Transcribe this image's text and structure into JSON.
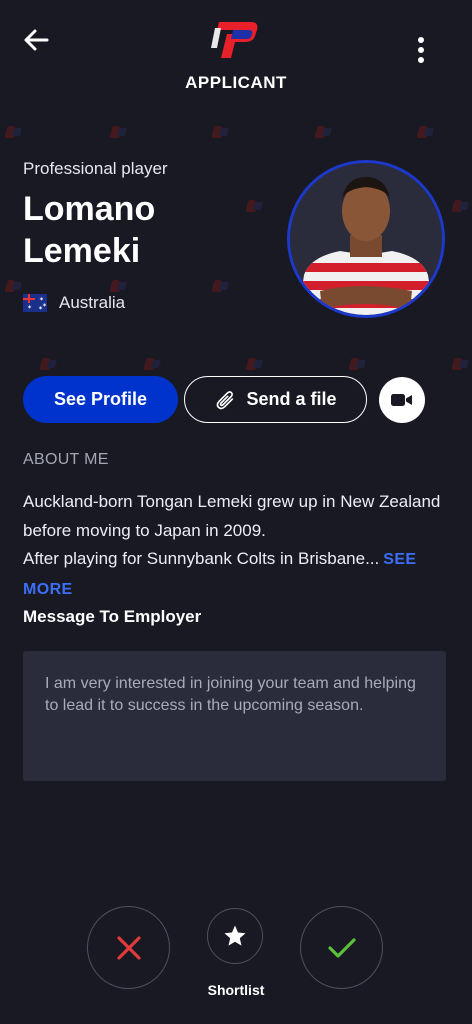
{
  "header": {
    "title": "APPLICANT",
    "back_icon": "arrow-left-icon",
    "menu_icon": "more-vertical-icon"
  },
  "applicant": {
    "role": "Professional player",
    "name": "Lomano Lemeki",
    "country": "Australia"
  },
  "actions": {
    "see_profile": "See Profile",
    "send_file": "Send a file",
    "video_icon": "video-camera-icon"
  },
  "about": {
    "heading": "ABOUT ME",
    "text_line1": "Auckland-born Tongan Lemeki grew up in New Zealand before moving to Japan in 2009.",
    "text_line2": "After playing for Sunnybank Colts in Brisbane...",
    "see_more": "SEE MORE"
  },
  "message": {
    "heading": "Message To Employer",
    "body": "I am very interested in joining your team and helping to lead it to success in the upcoming season."
  },
  "decision": {
    "shortlist_label": "Shortlist"
  },
  "colors": {
    "background": "#181923",
    "primary": "#0033cc",
    "link": "#3d6ef6",
    "reject": "#e03a3a",
    "accept": "#5cbf3a"
  }
}
